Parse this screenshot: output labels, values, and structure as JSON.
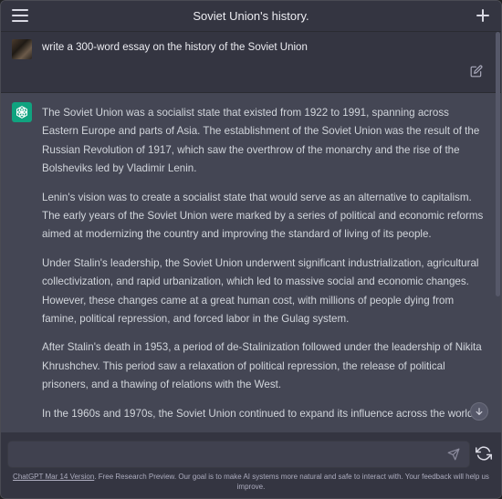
{
  "header": {
    "title": "Soviet Union's history.",
    "menu_icon": "hamburger-icon",
    "new_chat_icon": "plus-icon"
  },
  "user_message": {
    "text": "write a 300-word essay on the history of the Soviet Union",
    "edit_icon": "edit-icon"
  },
  "assistant_message": {
    "paragraphs": [
      "The Soviet Union was a socialist state that existed from 1922 to 1991, spanning across Eastern Europe and parts of Asia. The establishment of the Soviet Union was the result of the Russian Revolution of 1917, which saw the overthrow of the monarchy and the rise of the Bolsheviks led by Vladimir Lenin.",
      "Lenin's vision was to create a socialist state that would serve as an alternative to capitalism. The early years of the Soviet Union were marked by a series of political and economic reforms aimed at modernizing the country and improving the standard of living of its people.",
      "Under Stalin's leadership, the Soviet Union underwent significant industrialization, agricultural collectivization, and rapid urbanization, which led to massive social and economic changes. However, these changes came at a great human cost, with millions of people dying from famine, political repression, and forced labor in the Gulag system.",
      "After Stalin's death in 1953, a period of de-Stalinization followed under the leadership of Nikita Khrushchev. This period saw a relaxation of political repression, the release of political prisoners, and a thawing of relations with the West.",
      "In the 1960s and 1970s, the Soviet Union continued to expand its influence across the world,"
    ]
  },
  "composer": {
    "placeholder": "",
    "value": ""
  },
  "footer": {
    "link_text": "ChatGPT Mar 14 Version",
    "text": ". Free Research Preview. Our goal is to make AI systems more natural and safe to interact with. Your feedback will help us improve."
  },
  "colors": {
    "background": "#343541",
    "assistant_bg": "#444654",
    "accent": "#10a37f"
  }
}
